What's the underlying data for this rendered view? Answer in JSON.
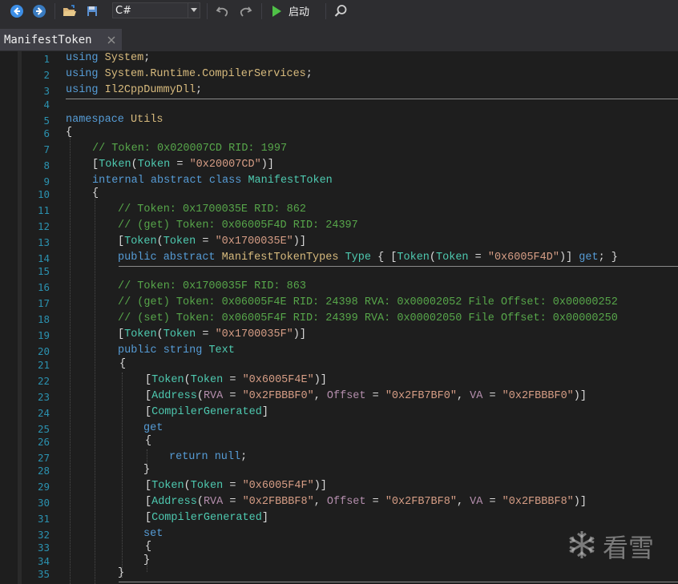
{
  "toolbar": {
    "icons": [
      "back-arrow-icon",
      "forward-arrow-icon",
      "open-folder-icon",
      "save-icon",
      "undo-icon",
      "redo-icon",
      "play-icon",
      "search-icon"
    ],
    "language": "C#",
    "run_label": "启动"
  },
  "tab": {
    "title": "ManifestToken"
  },
  "line_numbers": [
    "1",
    "2",
    "3",
    "4",
    "5",
    "6",
    "7",
    "8",
    "9",
    "10",
    "11",
    "12",
    "13",
    "14",
    "15",
    "16",
    "17",
    "18",
    "19",
    "20",
    "21",
    "22",
    "23",
    "24",
    "25",
    "26",
    "27",
    "28",
    "29",
    "30",
    "31",
    "32",
    "33",
    "34",
    "35"
  ],
  "code": {
    "l1": {
      "a": "using",
      "b": "System",
      "c": ";"
    },
    "l2": {
      "a": "using",
      "b": "System.Runtime.CompilerServices",
      "c": ";"
    },
    "l3": {
      "a": "using",
      "b": "Il2CppDummyDll",
      "c": ";"
    },
    "l5": {
      "a": "namespace",
      "b": "Utils"
    },
    "l6": {
      "a": "{"
    },
    "l7": {
      "a": "// Token: 0x020007CD RID: 1997"
    },
    "l8": {
      "a": "[",
      "b": "Token",
      "c": "(",
      "d": "Token",
      "e": " = ",
      "f": "\"0x20007CD\"",
      "g": ")]"
    },
    "l9": {
      "a": "internal abstract class",
      "b": "ManifestToken"
    },
    "l10": {
      "a": "{"
    },
    "l11": {
      "a": "// Token: 0x1700035E RID: 862"
    },
    "l12": {
      "a": "// (get) Token: 0x06005F4D RID: 24397"
    },
    "l13": {
      "a": "[",
      "b": "Token",
      "c": "(",
      "d": "Token",
      "e": " = ",
      "f": "\"0x1700035E\"",
      "g": ")]"
    },
    "l14": {
      "a": "public abstract",
      "b": "ManifestTokenTypes",
      "c": "Type",
      "d": " { [",
      "e": "Token",
      "f": "(",
      "g": "Token",
      "h": " = ",
      "i": "\"0x6005F4D\"",
      "j": ")] ",
      "k": "get",
      "l": "; }"
    },
    "l16": {
      "a": "// Token: 0x1700035F RID: 863"
    },
    "l17": {
      "a": "// (get) Token: 0x06005F4E RID: 24398 RVA: 0x00002052 File Offset: 0x00000252"
    },
    "l18": {
      "a": "// (set) Token: 0x06005F4F RID: 24399 RVA: 0x00002050 File Offset: 0x00000250"
    },
    "l19": {
      "a": "[",
      "b": "Token",
      "c": "(",
      "d": "Token",
      "e": " = ",
      "f": "\"0x1700035F\"",
      "g": ")]"
    },
    "l20": {
      "a": "public string",
      "b": "Text"
    },
    "l21": {
      "a": "{"
    },
    "l22": {
      "a": "[",
      "b": "Token",
      "c": "(",
      "d": "Token",
      "e": " = ",
      "f": "\"0x6005F4E\"",
      "g": ")]"
    },
    "l23": {
      "a": "[",
      "b": "Address",
      "c": "(",
      "d": "RVA",
      "e": " = ",
      "f": "\"0x2FBBBF0\"",
      "g": ", ",
      "h": "Offset",
      "i": " = ",
      "j": "\"0x2FB7BF0\"",
      "k": ", ",
      "l": "VA",
      "m": " = ",
      "n": "\"0x2FBBBF0\"",
      "o": ")]"
    },
    "l24": {
      "a": "[",
      "b": "CompilerGenerated",
      "c": "]"
    },
    "l25": {
      "a": "get"
    },
    "l26": {
      "a": "{"
    },
    "l27": {
      "a": "return null",
      "b": ";"
    },
    "l28": {
      "a": "}"
    },
    "l29": {
      "a": "[",
      "b": "Token",
      "c": "(",
      "d": "Token",
      "e": " = ",
      "f": "\"0x6005F4F\"",
      "g": ")]"
    },
    "l30": {
      "a": "[",
      "b": "Address",
      "c": "(",
      "d": "RVA",
      "e": " = ",
      "f": "\"0x2FBBBF8\"",
      "g": ", ",
      "h": "Offset",
      "i": " = ",
      "j": "\"0x2FB7BF8\"",
      "k": ", ",
      "l": "VA",
      "m": " = ",
      "n": "\"0x2FBBBF8\"",
      "o": ")]"
    },
    "l31": {
      "a": "[",
      "b": "CompilerGenerated",
      "c": "]"
    },
    "l32": {
      "a": "set"
    },
    "l33": {
      "a": "{"
    },
    "l34": {
      "a": "}"
    },
    "l35": {
      "a": "}"
    }
  },
  "watermark": {
    "text": "看雪"
  },
  "colors": {
    "background": "#1e1e1e",
    "keyword": "#569cd6",
    "type": "#4ec9b0",
    "comment": "#57a64a",
    "string": "#d69d85",
    "property": "#b48ead",
    "identifier": "#d7ba7d",
    "line_number": "#2b91af"
  }
}
